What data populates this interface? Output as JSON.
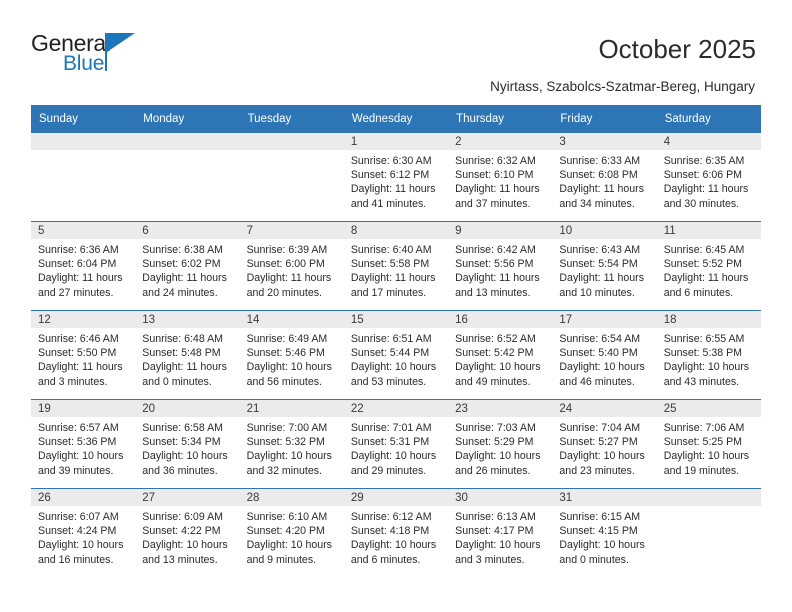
{
  "brand": {
    "name_top": "General",
    "name_bottom": "Blue",
    "color_primary": "#1b76bc"
  },
  "header": {
    "title": "October 2025",
    "subtitle": "Nyirtass, Szabolcs-Szatmar-Bereg, Hungary"
  },
  "theme": {
    "header_bg": "#2e75b6",
    "daynum_bg": "#ebebeb",
    "text": "#2b2b2b"
  },
  "weekdays": [
    "Sunday",
    "Monday",
    "Tuesday",
    "Wednesday",
    "Thursday",
    "Friday",
    "Saturday"
  ],
  "weeks": [
    [
      {
        "day": "",
        "empty": true
      },
      {
        "day": "",
        "empty": true
      },
      {
        "day": "",
        "empty": true
      },
      {
        "day": "1",
        "sunrise": "Sunrise: 6:30 AM",
        "sunset": "Sunset: 6:12 PM",
        "daylight1": "Daylight: 11 hours",
        "daylight2": "and 41 minutes."
      },
      {
        "day": "2",
        "sunrise": "Sunrise: 6:32 AM",
        "sunset": "Sunset: 6:10 PM",
        "daylight1": "Daylight: 11 hours",
        "daylight2": "and 37 minutes."
      },
      {
        "day": "3",
        "sunrise": "Sunrise: 6:33 AM",
        "sunset": "Sunset: 6:08 PM",
        "daylight1": "Daylight: 11 hours",
        "daylight2": "and 34 minutes."
      },
      {
        "day": "4",
        "sunrise": "Sunrise: 6:35 AM",
        "sunset": "Sunset: 6:06 PM",
        "daylight1": "Daylight: 11 hours",
        "daylight2": "and 30 minutes."
      }
    ],
    [
      {
        "day": "5",
        "sunrise": "Sunrise: 6:36 AM",
        "sunset": "Sunset: 6:04 PM",
        "daylight1": "Daylight: 11 hours",
        "daylight2": "and 27 minutes."
      },
      {
        "day": "6",
        "sunrise": "Sunrise: 6:38 AM",
        "sunset": "Sunset: 6:02 PM",
        "daylight1": "Daylight: 11 hours",
        "daylight2": "and 24 minutes."
      },
      {
        "day": "7",
        "sunrise": "Sunrise: 6:39 AM",
        "sunset": "Sunset: 6:00 PM",
        "daylight1": "Daylight: 11 hours",
        "daylight2": "and 20 minutes."
      },
      {
        "day": "8",
        "sunrise": "Sunrise: 6:40 AM",
        "sunset": "Sunset: 5:58 PM",
        "daylight1": "Daylight: 11 hours",
        "daylight2": "and 17 minutes."
      },
      {
        "day": "9",
        "sunrise": "Sunrise: 6:42 AM",
        "sunset": "Sunset: 5:56 PM",
        "daylight1": "Daylight: 11 hours",
        "daylight2": "and 13 minutes."
      },
      {
        "day": "10",
        "sunrise": "Sunrise: 6:43 AM",
        "sunset": "Sunset: 5:54 PM",
        "daylight1": "Daylight: 11 hours",
        "daylight2": "and 10 minutes."
      },
      {
        "day": "11",
        "sunrise": "Sunrise: 6:45 AM",
        "sunset": "Sunset: 5:52 PM",
        "daylight1": "Daylight: 11 hours",
        "daylight2": "and 6 minutes."
      }
    ],
    [
      {
        "day": "12",
        "sunrise": "Sunrise: 6:46 AM",
        "sunset": "Sunset: 5:50 PM",
        "daylight1": "Daylight: 11 hours",
        "daylight2": "and 3 minutes."
      },
      {
        "day": "13",
        "sunrise": "Sunrise: 6:48 AM",
        "sunset": "Sunset: 5:48 PM",
        "daylight1": "Daylight: 11 hours",
        "daylight2": "and 0 minutes."
      },
      {
        "day": "14",
        "sunrise": "Sunrise: 6:49 AM",
        "sunset": "Sunset: 5:46 PM",
        "daylight1": "Daylight: 10 hours",
        "daylight2": "and 56 minutes."
      },
      {
        "day": "15",
        "sunrise": "Sunrise: 6:51 AM",
        "sunset": "Sunset: 5:44 PM",
        "daylight1": "Daylight: 10 hours",
        "daylight2": "and 53 minutes."
      },
      {
        "day": "16",
        "sunrise": "Sunrise: 6:52 AM",
        "sunset": "Sunset: 5:42 PM",
        "daylight1": "Daylight: 10 hours",
        "daylight2": "and 49 minutes."
      },
      {
        "day": "17",
        "sunrise": "Sunrise: 6:54 AM",
        "sunset": "Sunset: 5:40 PM",
        "daylight1": "Daylight: 10 hours",
        "daylight2": "and 46 minutes."
      },
      {
        "day": "18",
        "sunrise": "Sunrise: 6:55 AM",
        "sunset": "Sunset: 5:38 PM",
        "daylight1": "Daylight: 10 hours",
        "daylight2": "and 43 minutes."
      }
    ],
    [
      {
        "day": "19",
        "sunrise": "Sunrise: 6:57 AM",
        "sunset": "Sunset: 5:36 PM",
        "daylight1": "Daylight: 10 hours",
        "daylight2": "and 39 minutes."
      },
      {
        "day": "20",
        "sunrise": "Sunrise: 6:58 AM",
        "sunset": "Sunset: 5:34 PM",
        "daylight1": "Daylight: 10 hours",
        "daylight2": "and 36 minutes."
      },
      {
        "day": "21",
        "sunrise": "Sunrise: 7:00 AM",
        "sunset": "Sunset: 5:32 PM",
        "daylight1": "Daylight: 10 hours",
        "daylight2": "and 32 minutes."
      },
      {
        "day": "22",
        "sunrise": "Sunrise: 7:01 AM",
        "sunset": "Sunset: 5:31 PM",
        "daylight1": "Daylight: 10 hours",
        "daylight2": "and 29 minutes."
      },
      {
        "day": "23",
        "sunrise": "Sunrise: 7:03 AM",
        "sunset": "Sunset: 5:29 PM",
        "daylight1": "Daylight: 10 hours",
        "daylight2": "and 26 minutes."
      },
      {
        "day": "24",
        "sunrise": "Sunrise: 7:04 AM",
        "sunset": "Sunset: 5:27 PM",
        "daylight1": "Daylight: 10 hours",
        "daylight2": "and 23 minutes."
      },
      {
        "day": "25",
        "sunrise": "Sunrise: 7:06 AM",
        "sunset": "Sunset: 5:25 PM",
        "daylight1": "Daylight: 10 hours",
        "daylight2": "and 19 minutes."
      }
    ],
    [
      {
        "day": "26",
        "sunrise": "Sunrise: 6:07 AM",
        "sunset": "Sunset: 4:24 PM",
        "daylight1": "Daylight: 10 hours",
        "daylight2": "and 16 minutes."
      },
      {
        "day": "27",
        "sunrise": "Sunrise: 6:09 AM",
        "sunset": "Sunset: 4:22 PM",
        "daylight1": "Daylight: 10 hours",
        "daylight2": "and 13 minutes."
      },
      {
        "day": "28",
        "sunrise": "Sunrise: 6:10 AM",
        "sunset": "Sunset: 4:20 PM",
        "daylight1": "Daylight: 10 hours",
        "daylight2": "and 9 minutes."
      },
      {
        "day": "29",
        "sunrise": "Sunrise: 6:12 AM",
        "sunset": "Sunset: 4:18 PM",
        "daylight1": "Daylight: 10 hours",
        "daylight2": "and 6 minutes."
      },
      {
        "day": "30",
        "sunrise": "Sunrise: 6:13 AM",
        "sunset": "Sunset: 4:17 PM",
        "daylight1": "Daylight: 10 hours",
        "daylight2": "and 3 minutes."
      },
      {
        "day": "31",
        "sunrise": "Sunrise: 6:15 AM",
        "sunset": "Sunset: 4:15 PM",
        "daylight1": "Daylight: 10 hours",
        "daylight2": "and 0 minutes."
      },
      {
        "day": "",
        "empty": true
      }
    ]
  ]
}
